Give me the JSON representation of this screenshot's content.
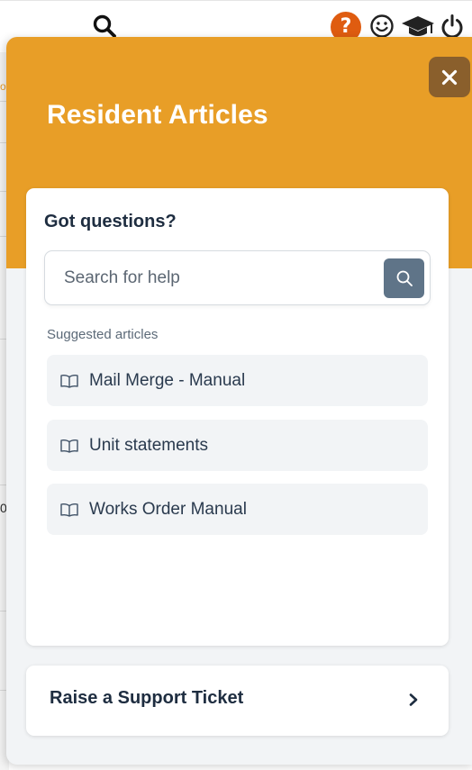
{
  "background": {
    "edge_chars": [
      "o",
      "0"
    ]
  },
  "topbar": {
    "search_icon": "search-icon",
    "help_badge": "?",
    "help_color": "#df5c10",
    "icons": [
      "help-icon",
      "smiley-icon",
      "graduation-cap-icon",
      "power-icon"
    ]
  },
  "help_panel": {
    "title": "Resident Articles",
    "header_color": "#e89e27",
    "close_icon": "close-icon",
    "card": {
      "heading": "Got questions?",
      "search": {
        "placeholder": "Search for help",
        "value": ""
      },
      "suggested_label": "Suggested articles",
      "articles": [
        {
          "label": "Mail Merge - Manual",
          "icon": "book-icon"
        },
        {
          "label": "Unit statements",
          "icon": "book-icon"
        },
        {
          "label": "Works Order Manual",
          "icon": "book-icon"
        }
      ]
    },
    "support_ticket": {
      "label": "Raise a Support Ticket",
      "icon": "chevron-right-icon"
    }
  }
}
